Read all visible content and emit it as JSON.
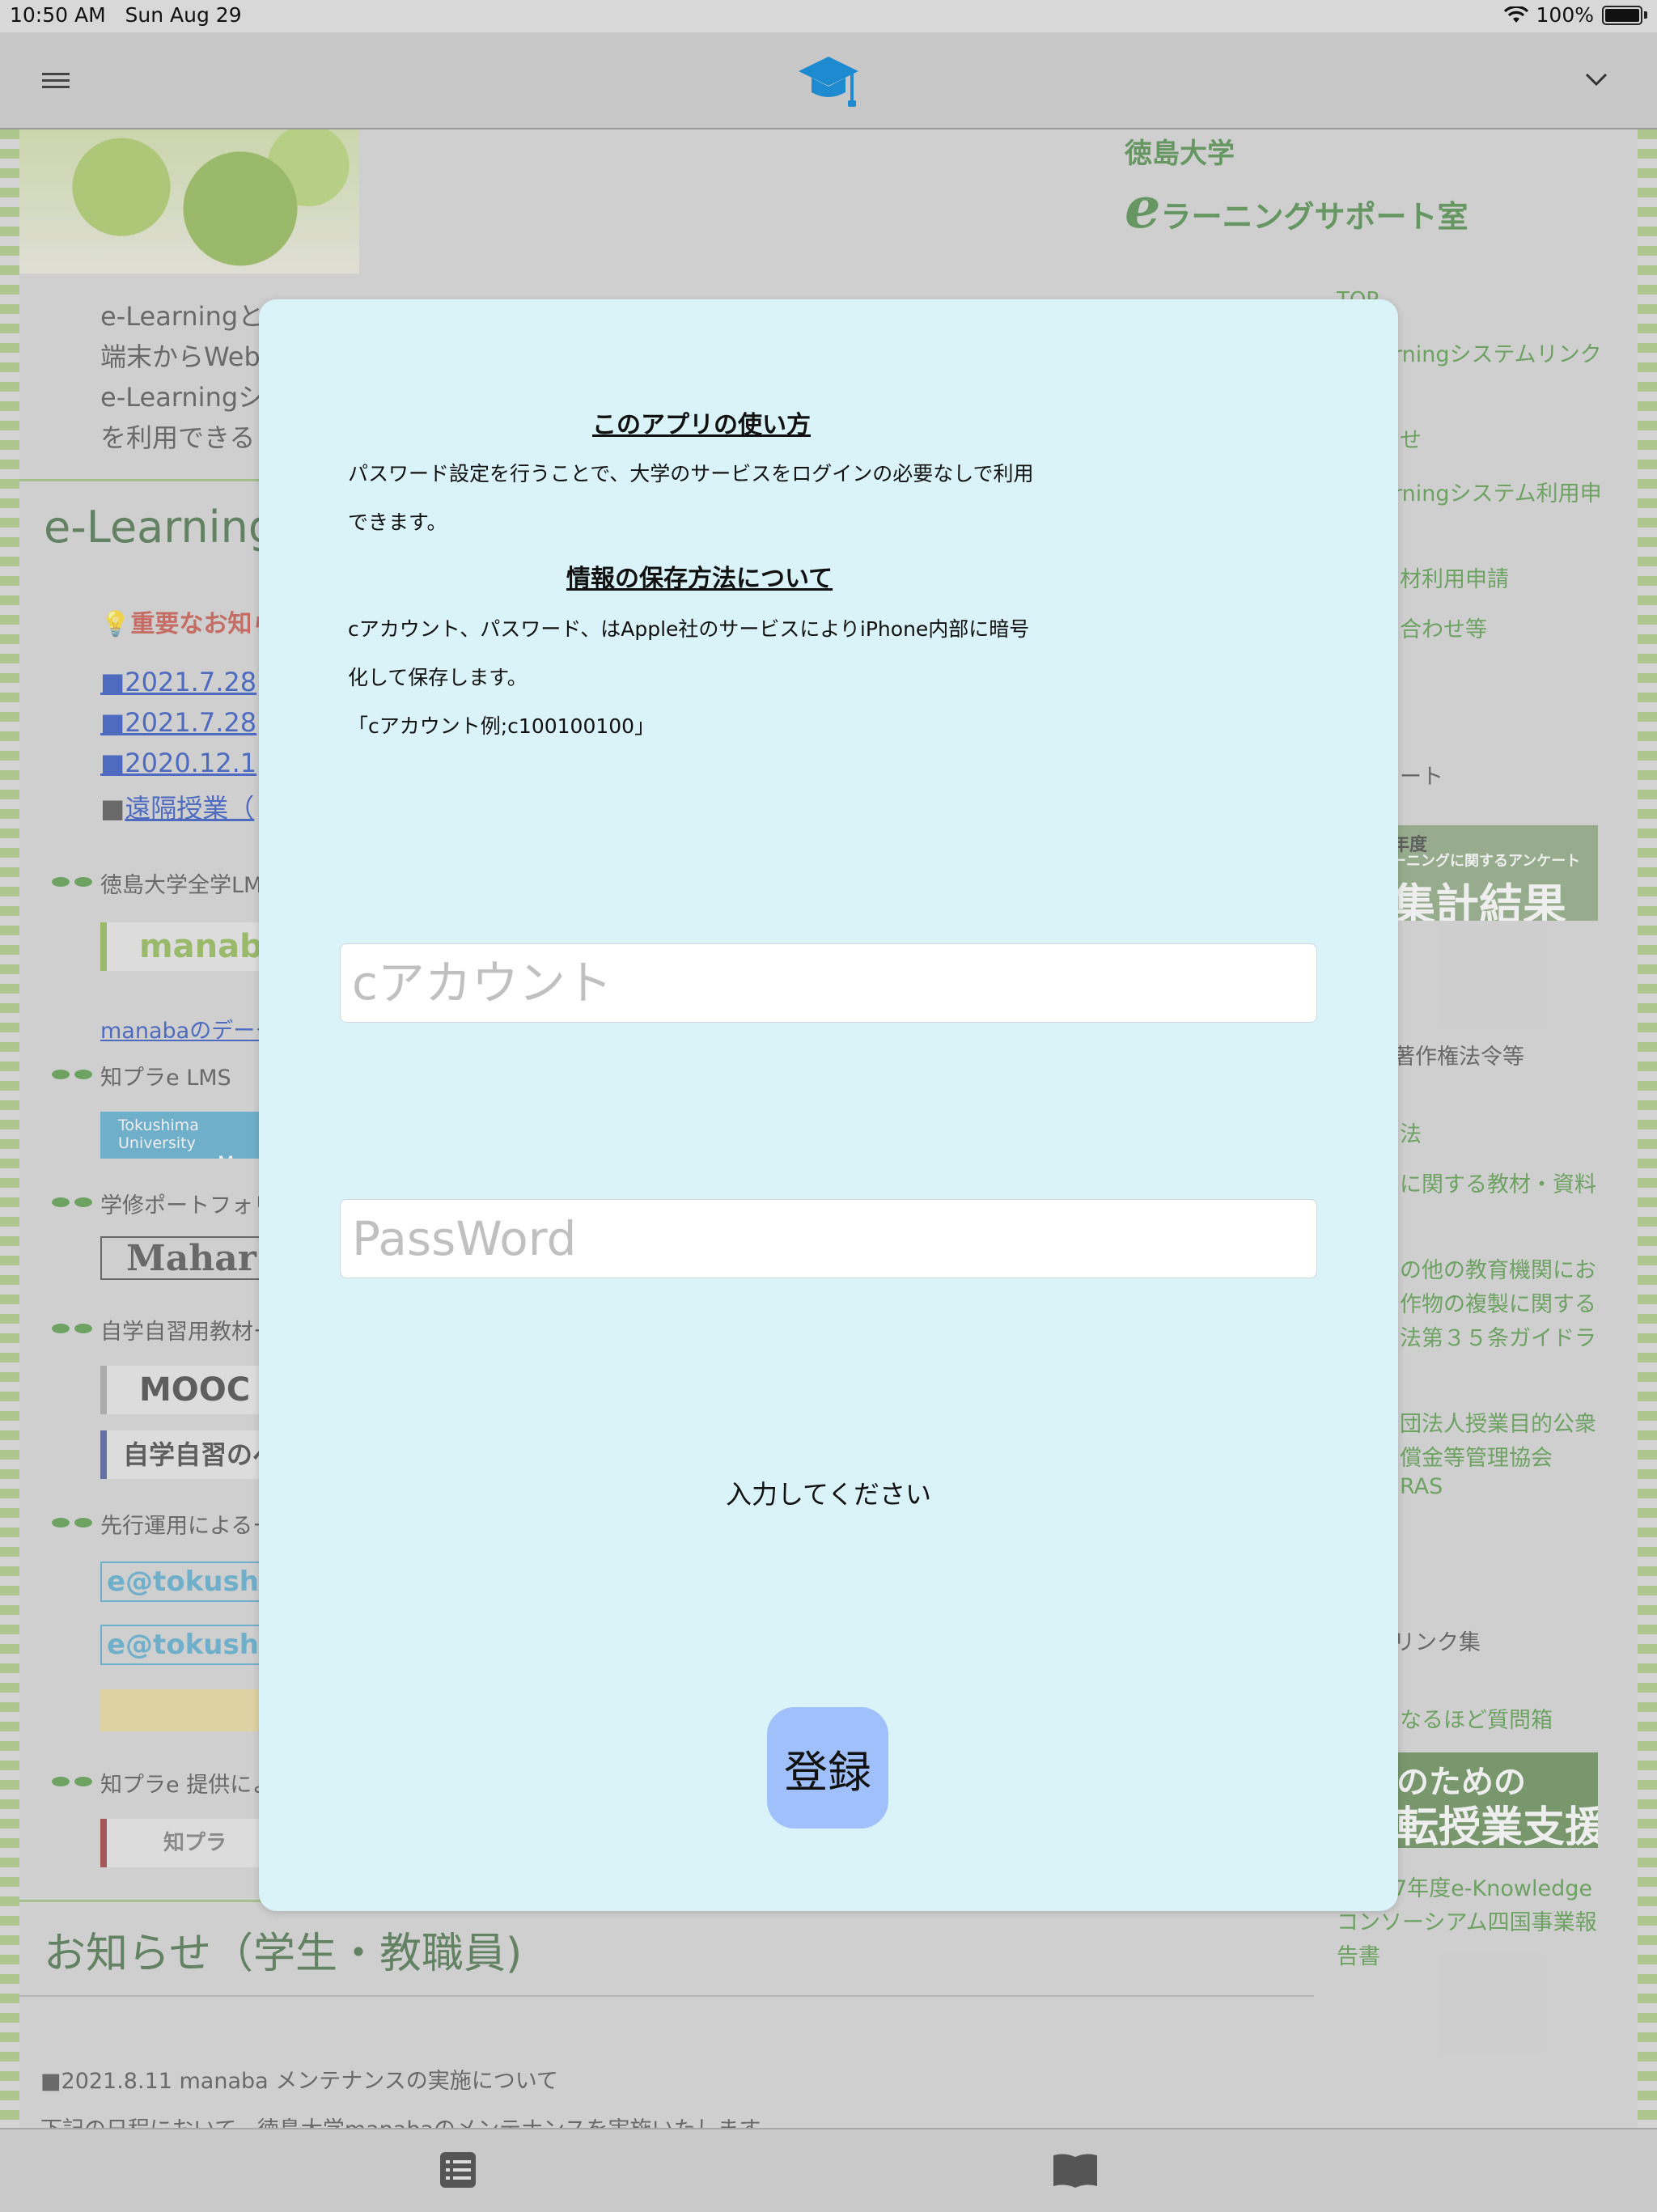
{
  "status_bar": {
    "time": "10:50 AM",
    "date": "Sun Aug 29",
    "battery": "100%"
  },
  "icons": {
    "menu": "hamburger-icon",
    "app": "graduation-cap-icon",
    "chevron": "chevron-down-icon",
    "tab1": "list-icon",
    "tab2": "book-icon"
  },
  "colors": {
    "modal_bg": "#d9f3f8",
    "button_bg": "#9fc0fa",
    "site_green": "#2f7a2a"
  },
  "background": {
    "logo_line1": "徳島大学",
    "logo_e": "e",
    "logo_line2": "ラーニングサポート室",
    "intro": [
      "e-Learningと",
      "端末からWeb",
      "e-Learningシ",
      "を利用できる"
    ],
    "heading_elearning": "e-Learning",
    "important": "重要なお知ら",
    "news_links": [
      "■2021.7.28",
      "■2021.7.28",
      "■2020.12.1"
    ],
    "remote_prefix": "■",
    "remote_link": "遠隔授業（",
    "sections": [
      "徳島大学全学LM",
      "知プラe LMS",
      "学修ポートフォリ",
      "自学自習用教材ー",
      "先行運用によるー",
      "知プラe 提供によ"
    ],
    "manaba": "manaba",
    "manaba_data": "manabaのデータ",
    "moodle_banner": "Tokushima University",
    "moodle_banner2": "Mood",
    "mahara": "Mahar",
    "mooc": "MOOC",
    "jigaku": "自学自習のペ",
    "etoku1": "e@tokushim",
    "etoku2": "e@tokushim",
    "chipura": "知プラ",
    "notice_heading": "お知らせ（学生・教職員)",
    "notice_item": "■2021.8.11 manaba メンテナンスの実施について",
    "notice_sub": "下記の日程において、徳島大学manabaのメンテナンスを実施いたします。",
    "right_menu": [
      "TOP",
      "rningシステムリンク",
      "せ",
      "rningシステム利用申",
      "材利用申請",
      "合わせ等",
      "ート",
      "著作権法令等",
      "法",
      "に関する教材・資料",
      "の他の教育機関にお",
      "作物の複製に関する",
      "法第３５条ガイドラ",
      "団法人授業目的公衆",
      "償金等管理協会",
      "RAS",
      "リンク集",
      "なるほど質問箱",
      "7年度e-Knowledge",
      "コンソーシアム四国事業報",
      "告書"
    ],
    "survey_banner": [
      "年度",
      "ーニングに関するアンケート",
      "集計結果"
    ],
    "support_banner": [
      "のための",
      "転授業支援"
    ]
  },
  "modal": {
    "usage_title": "このアプリの使い方",
    "usage_line1": "パスワード設定を行うことで、大学のサービスをログインの必要なしで利用",
    "usage_line2": "できます。",
    "storage_title": "情報の保存方法について",
    "storage_line1": "cアカウント、パスワード、はApple社のサービスによりiPhone内部に暗号",
    "storage_line2": "化して保存します。",
    "storage_example": "「cアカウント例;c100100100」",
    "account_placeholder": "cアカウント",
    "password_placeholder": "PassWord",
    "message": "入力してください",
    "register_label": "登録"
  }
}
